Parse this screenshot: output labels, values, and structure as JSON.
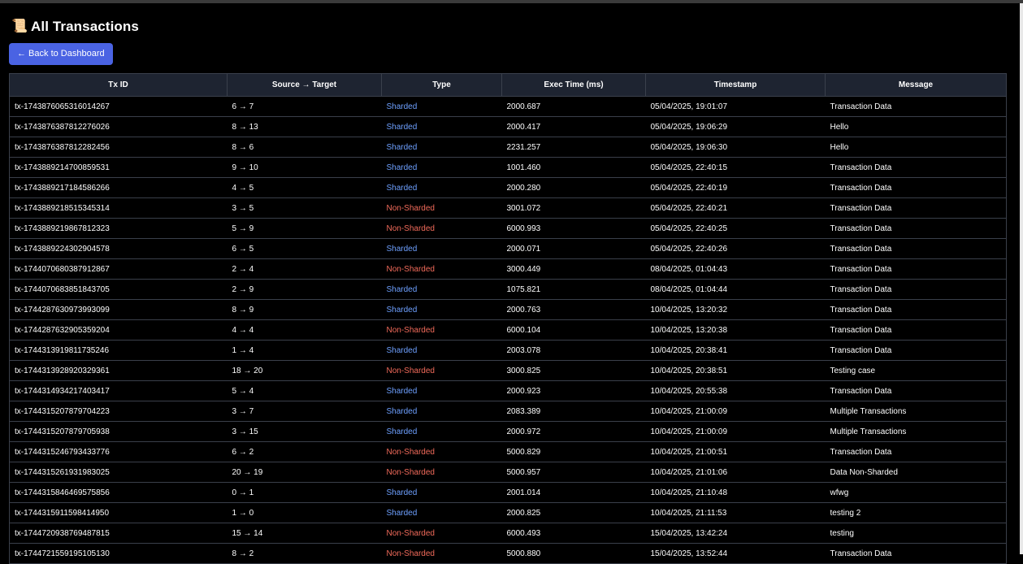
{
  "header": {
    "title": "All Transactions",
    "back_label": "← Back to Dashboard"
  },
  "colors": {
    "sharded": "#6ea0ff",
    "non_sharded": "#f26b5b",
    "button": "#4a63e3",
    "header_bg": "#1e2431"
  },
  "table": {
    "columns": [
      "Tx ID",
      "Source → Target",
      "Type",
      "Exec Time (ms)",
      "Timestamp",
      "Message"
    ],
    "rows": [
      {
        "id": "tx-1743876065316014267",
        "route": "6 → 7",
        "type": "Sharded",
        "exec": "2000.687",
        "ts": "05/04/2025, 19:01:07",
        "msg": "Transaction Data"
      },
      {
        "id": "tx-1743876387812276026",
        "route": "8 → 13",
        "type": "Sharded",
        "exec": "2000.417",
        "ts": "05/04/2025, 19:06:29",
        "msg": "Hello"
      },
      {
        "id": "tx-1743876387812282456",
        "route": "8 → 6",
        "type": "Sharded",
        "exec": "2231.257",
        "ts": "05/04/2025, 19:06:30",
        "msg": "Hello"
      },
      {
        "id": "tx-1743889214700859531",
        "route": "9 → 10",
        "type": "Sharded",
        "exec": "1001.460",
        "ts": "05/04/2025, 22:40:15",
        "msg": "Transaction Data"
      },
      {
        "id": "tx-1743889217184586266",
        "route": "4 → 5",
        "type": "Sharded",
        "exec": "2000.280",
        "ts": "05/04/2025, 22:40:19",
        "msg": "Transaction Data"
      },
      {
        "id": "tx-1743889218515345314",
        "route": "3 → 5",
        "type": "Non-Sharded",
        "exec": "3001.072",
        "ts": "05/04/2025, 22:40:21",
        "msg": "Transaction Data"
      },
      {
        "id": "tx-1743889219867812323",
        "route": "5 → 9",
        "type": "Non-Sharded",
        "exec": "6000.993",
        "ts": "05/04/2025, 22:40:25",
        "msg": "Transaction Data"
      },
      {
        "id": "tx-1743889224302904578",
        "route": "6 → 5",
        "type": "Sharded",
        "exec": "2000.071",
        "ts": "05/04/2025, 22:40:26",
        "msg": "Transaction Data"
      },
      {
        "id": "tx-1744070680387912867",
        "route": "2 → 4",
        "type": "Non-Sharded",
        "exec": "3000.449",
        "ts": "08/04/2025, 01:04:43",
        "msg": "Transaction Data"
      },
      {
        "id": "tx-1744070683851843705",
        "route": "2 → 9",
        "type": "Sharded",
        "exec": "1075.821",
        "ts": "08/04/2025, 01:04:44",
        "msg": "Transaction Data"
      },
      {
        "id": "tx-1744287630973993099",
        "route": "8 → 9",
        "type": "Sharded",
        "exec": "2000.763",
        "ts": "10/04/2025, 13:20:32",
        "msg": "Transaction Data"
      },
      {
        "id": "tx-1744287632905359204",
        "route": "4 → 4",
        "type": "Non-Sharded",
        "exec": "6000.104",
        "ts": "10/04/2025, 13:20:38",
        "msg": "Transaction Data"
      },
      {
        "id": "tx-1744313919811735246",
        "route": "1 → 4",
        "type": "Sharded",
        "exec": "2003.078",
        "ts": "10/04/2025, 20:38:41",
        "msg": "Transaction Data"
      },
      {
        "id": "tx-1744313928920329361",
        "route": "18 → 20",
        "type": "Non-Sharded",
        "exec": "3000.825",
        "ts": "10/04/2025, 20:38:51",
        "msg": "Testing case"
      },
      {
        "id": "tx-1744314934217403417",
        "route": "5 → 4",
        "type": "Sharded",
        "exec": "2000.923",
        "ts": "10/04/2025, 20:55:38",
        "msg": "Transaction Data"
      },
      {
        "id": "tx-1744315207879704223",
        "route": "3 → 7",
        "type": "Sharded",
        "exec": "2083.389",
        "ts": "10/04/2025, 21:00:09",
        "msg": "Multiple Transactions"
      },
      {
        "id": "tx-1744315207879705938",
        "route": "3 → 15",
        "type": "Sharded",
        "exec": "2000.972",
        "ts": "10/04/2025, 21:00:09",
        "msg": "Multiple Transactions"
      },
      {
        "id": "tx-1744315246793433776",
        "route": "6 → 2",
        "type": "Non-Sharded",
        "exec": "5000.829",
        "ts": "10/04/2025, 21:00:51",
        "msg": "Transaction Data"
      },
      {
        "id": "tx-1744315261931983025",
        "route": "20 → 19",
        "type": "Non-Sharded",
        "exec": "5000.957",
        "ts": "10/04/2025, 21:01:06",
        "msg": "Data Non-Sharded"
      },
      {
        "id": "tx-1744315846469575856",
        "route": "0 → 1",
        "type": "Sharded",
        "exec": "2001.014",
        "ts": "10/04/2025, 21:10:48",
        "msg": "wfwg"
      },
      {
        "id": "tx-1744315911598414950",
        "route": "1 → 0",
        "type": "Sharded",
        "exec": "2000.825",
        "ts": "10/04/2025, 21:11:53",
        "msg": "testing 2"
      },
      {
        "id": "tx-1744720938769487815",
        "route": "15 → 14",
        "type": "Non-Sharded",
        "exec": "6000.493",
        "ts": "15/04/2025, 13:42:24",
        "msg": "testing"
      },
      {
        "id": "tx-1744721559195105130",
        "route": "8 → 2",
        "type": "Non-Sharded",
        "exec": "5000.880",
        "ts": "15/04/2025, 13:52:44",
        "msg": "Transaction Data"
      }
    ]
  }
}
